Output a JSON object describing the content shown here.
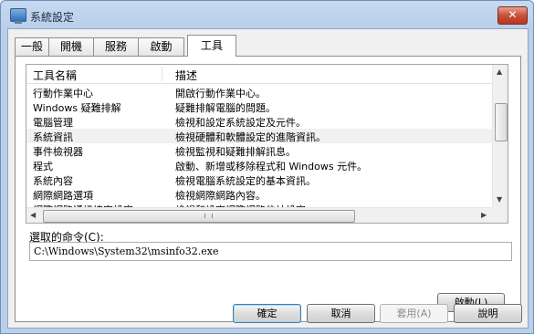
{
  "window": {
    "title": "系統設定",
    "close_glyph": "✕"
  },
  "tabs": [
    {
      "label": "一般",
      "active": false
    },
    {
      "label": "開機",
      "active": false
    },
    {
      "label": "服務",
      "active": false
    },
    {
      "label": "啟動",
      "active": false
    },
    {
      "label": "工具",
      "active": true
    }
  ],
  "tools_list": {
    "columns": [
      "工具名稱",
      "描述"
    ],
    "selected_index": 3,
    "rows": [
      {
        "name": "行動作業中心",
        "description": "開啟行動作業中心。"
      },
      {
        "name": "Windows 疑難排解",
        "description": "疑難排解電腦的問題。"
      },
      {
        "name": "電腦管理",
        "description": "檢視和設定系統設定及元件。"
      },
      {
        "name": "系統資訊",
        "description": "檢視硬體和軟體設定的進階資訊。"
      },
      {
        "name": "事件檢視器",
        "description": "檢視監視和疑難排解訊息。"
      },
      {
        "name": "程式",
        "description": "啟動、新增或移除程式和 Windows 元件。"
      },
      {
        "name": "系統內容",
        "description": "檢視電腦系統設定的基本資訊。"
      },
      {
        "name": "網際網路選項",
        "description": "檢視網際網路內容。"
      },
      {
        "name": "網際網路通訊協定設定",
        "description": "檢視和設定網際網路位址設定。"
      }
    ]
  },
  "command": {
    "label": "選取的命令(C):",
    "value": "C:\\Windows\\System32\\msinfo32.exe"
  },
  "buttons": {
    "launch": "啟動(L)",
    "ok": "確定",
    "cancel": "取消",
    "apply": "套用(A)",
    "help": "說明"
  }
}
